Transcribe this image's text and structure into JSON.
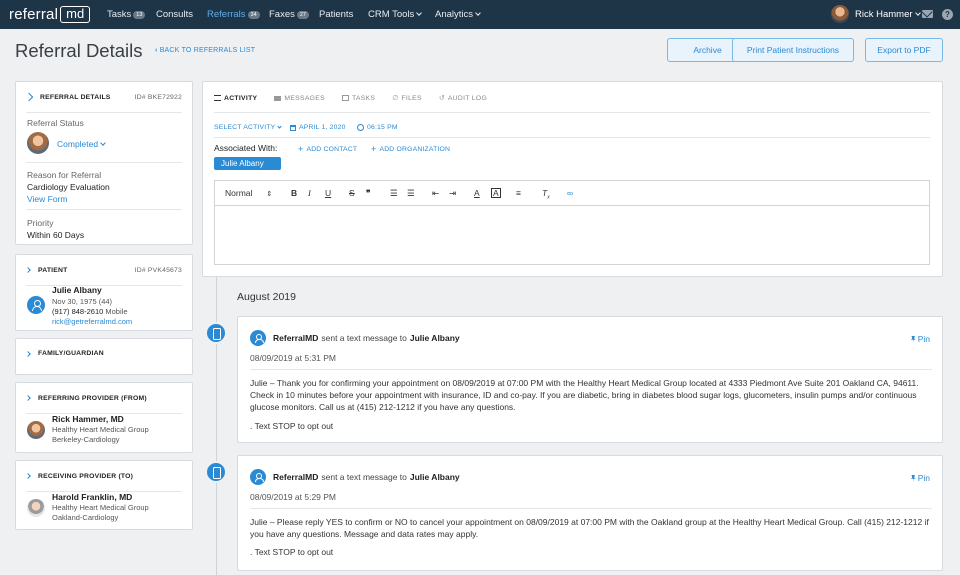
{
  "nav": {
    "logo_text": "referral",
    "logo_box": "md",
    "items": [
      {
        "label": "Tasks",
        "badge": "13"
      },
      {
        "label": "Consults",
        "badge": ""
      },
      {
        "label": "Referrals",
        "badge": "34"
      },
      {
        "label": "Faxes",
        "badge": "27"
      },
      {
        "label": "Patients",
        "badge": ""
      },
      {
        "label": "CRM Tools",
        "badge": ""
      },
      {
        "label": "Analytics",
        "badge": ""
      }
    ],
    "user": "Rick Hammer"
  },
  "header": {
    "title": "Referral Details",
    "back_link": "BACK TO REFERRALS LIST",
    "buttons": {
      "archive": "Archive",
      "print": "Print Patient Instructions",
      "export": "Export to PDF"
    }
  },
  "referral_card": {
    "title": "REFERRAL DETAILS",
    "id": "ID# BKE72922",
    "status_label": "Referral Status",
    "status_value": "Completed",
    "reason_label": "Reason for Referral",
    "reason_value": "Cardiology Evaluation",
    "view_form": "View Form",
    "priority_label": "Priority",
    "priority_value": "Within 60 Days"
  },
  "patient_card": {
    "title": "PATIENT",
    "id": "ID# PVK45673",
    "name": "Julie Albany",
    "dob": "Nov 30, 1975 (44)",
    "phone": "(917) 848-2610",
    "phone_type": "Mobile",
    "email": "rick@getreferralmd.com"
  },
  "family_card": {
    "title": "FAMILY/GUARDIAN"
  },
  "referring_card": {
    "title": "REFERRING PROVIDER (FROM)",
    "name": "Rick Hammer, MD",
    "org": "Healthy Heart Medical Group",
    "dept": "Berkeley-Cardiology"
  },
  "receiving_card": {
    "title": "RECEIVING PROVIDER (TO)",
    "name": "Harold Franklin, MD",
    "org": "Healthy Heart Medical Group",
    "dept": "Oakland-Cardiology"
  },
  "activity": {
    "tabs": [
      "ACTIVITY",
      "MESSAGES",
      "TASKS",
      "FILES",
      "AUDIT LOG"
    ],
    "select_activity": "SELECT ACTIVITY",
    "date": "APRIL 1, 2020",
    "time": "06:15 PM",
    "associated_label": "Associated With:",
    "add_contact": "ADD CONTACT",
    "add_org": "ADD ORGANIZATION",
    "chip": "Julie Albany",
    "toolbar_format": "Normal"
  },
  "timeline": {
    "month": "August 2019",
    "messages": [
      {
        "sender": "ReferralMD",
        "action": "sent a text message to",
        "recipient": "Julie Albany",
        "pin": "Pin",
        "date": "08/09/2019 at 5:31 PM",
        "body": "Julie – Thank you for confirming your appointment on 08/09/2019 at 07:00 PM with the Healthy Heart Medical Group located at 4333 Piedmont Ave Suite 201 Oakland CA, 94611. Check in 10 minutes before your appointment with insurance, ID and co-pay. If you are diabetic, bring in diabetes blood sugar logs, glucometers, insulin pumps and/or continuous glucose monitors. Call us at (415) 212-1212 if you have any questions.",
        "footer": ". Text STOP to opt out"
      },
      {
        "sender": "ReferralMD",
        "action": "sent a text message to",
        "recipient": "Julie Albany",
        "pin": "Pin",
        "date": "08/09/2019 at 5:29 PM",
        "body": "Julie – Please reply YES to confirm or NO to cancel your appointment on 08/09/2019 at 07:00 PM with the Oakland group at the Healthy Heart Medical Group. Call (415) 212-1212 if you have any questions. Message and data rates may apply.",
        "footer": ". Text STOP to opt out"
      }
    ]
  },
  "colors": {
    "nav_bg": "#1e3447",
    "accent": "#2a8ad4",
    "page_bg": "#eef0f2"
  }
}
